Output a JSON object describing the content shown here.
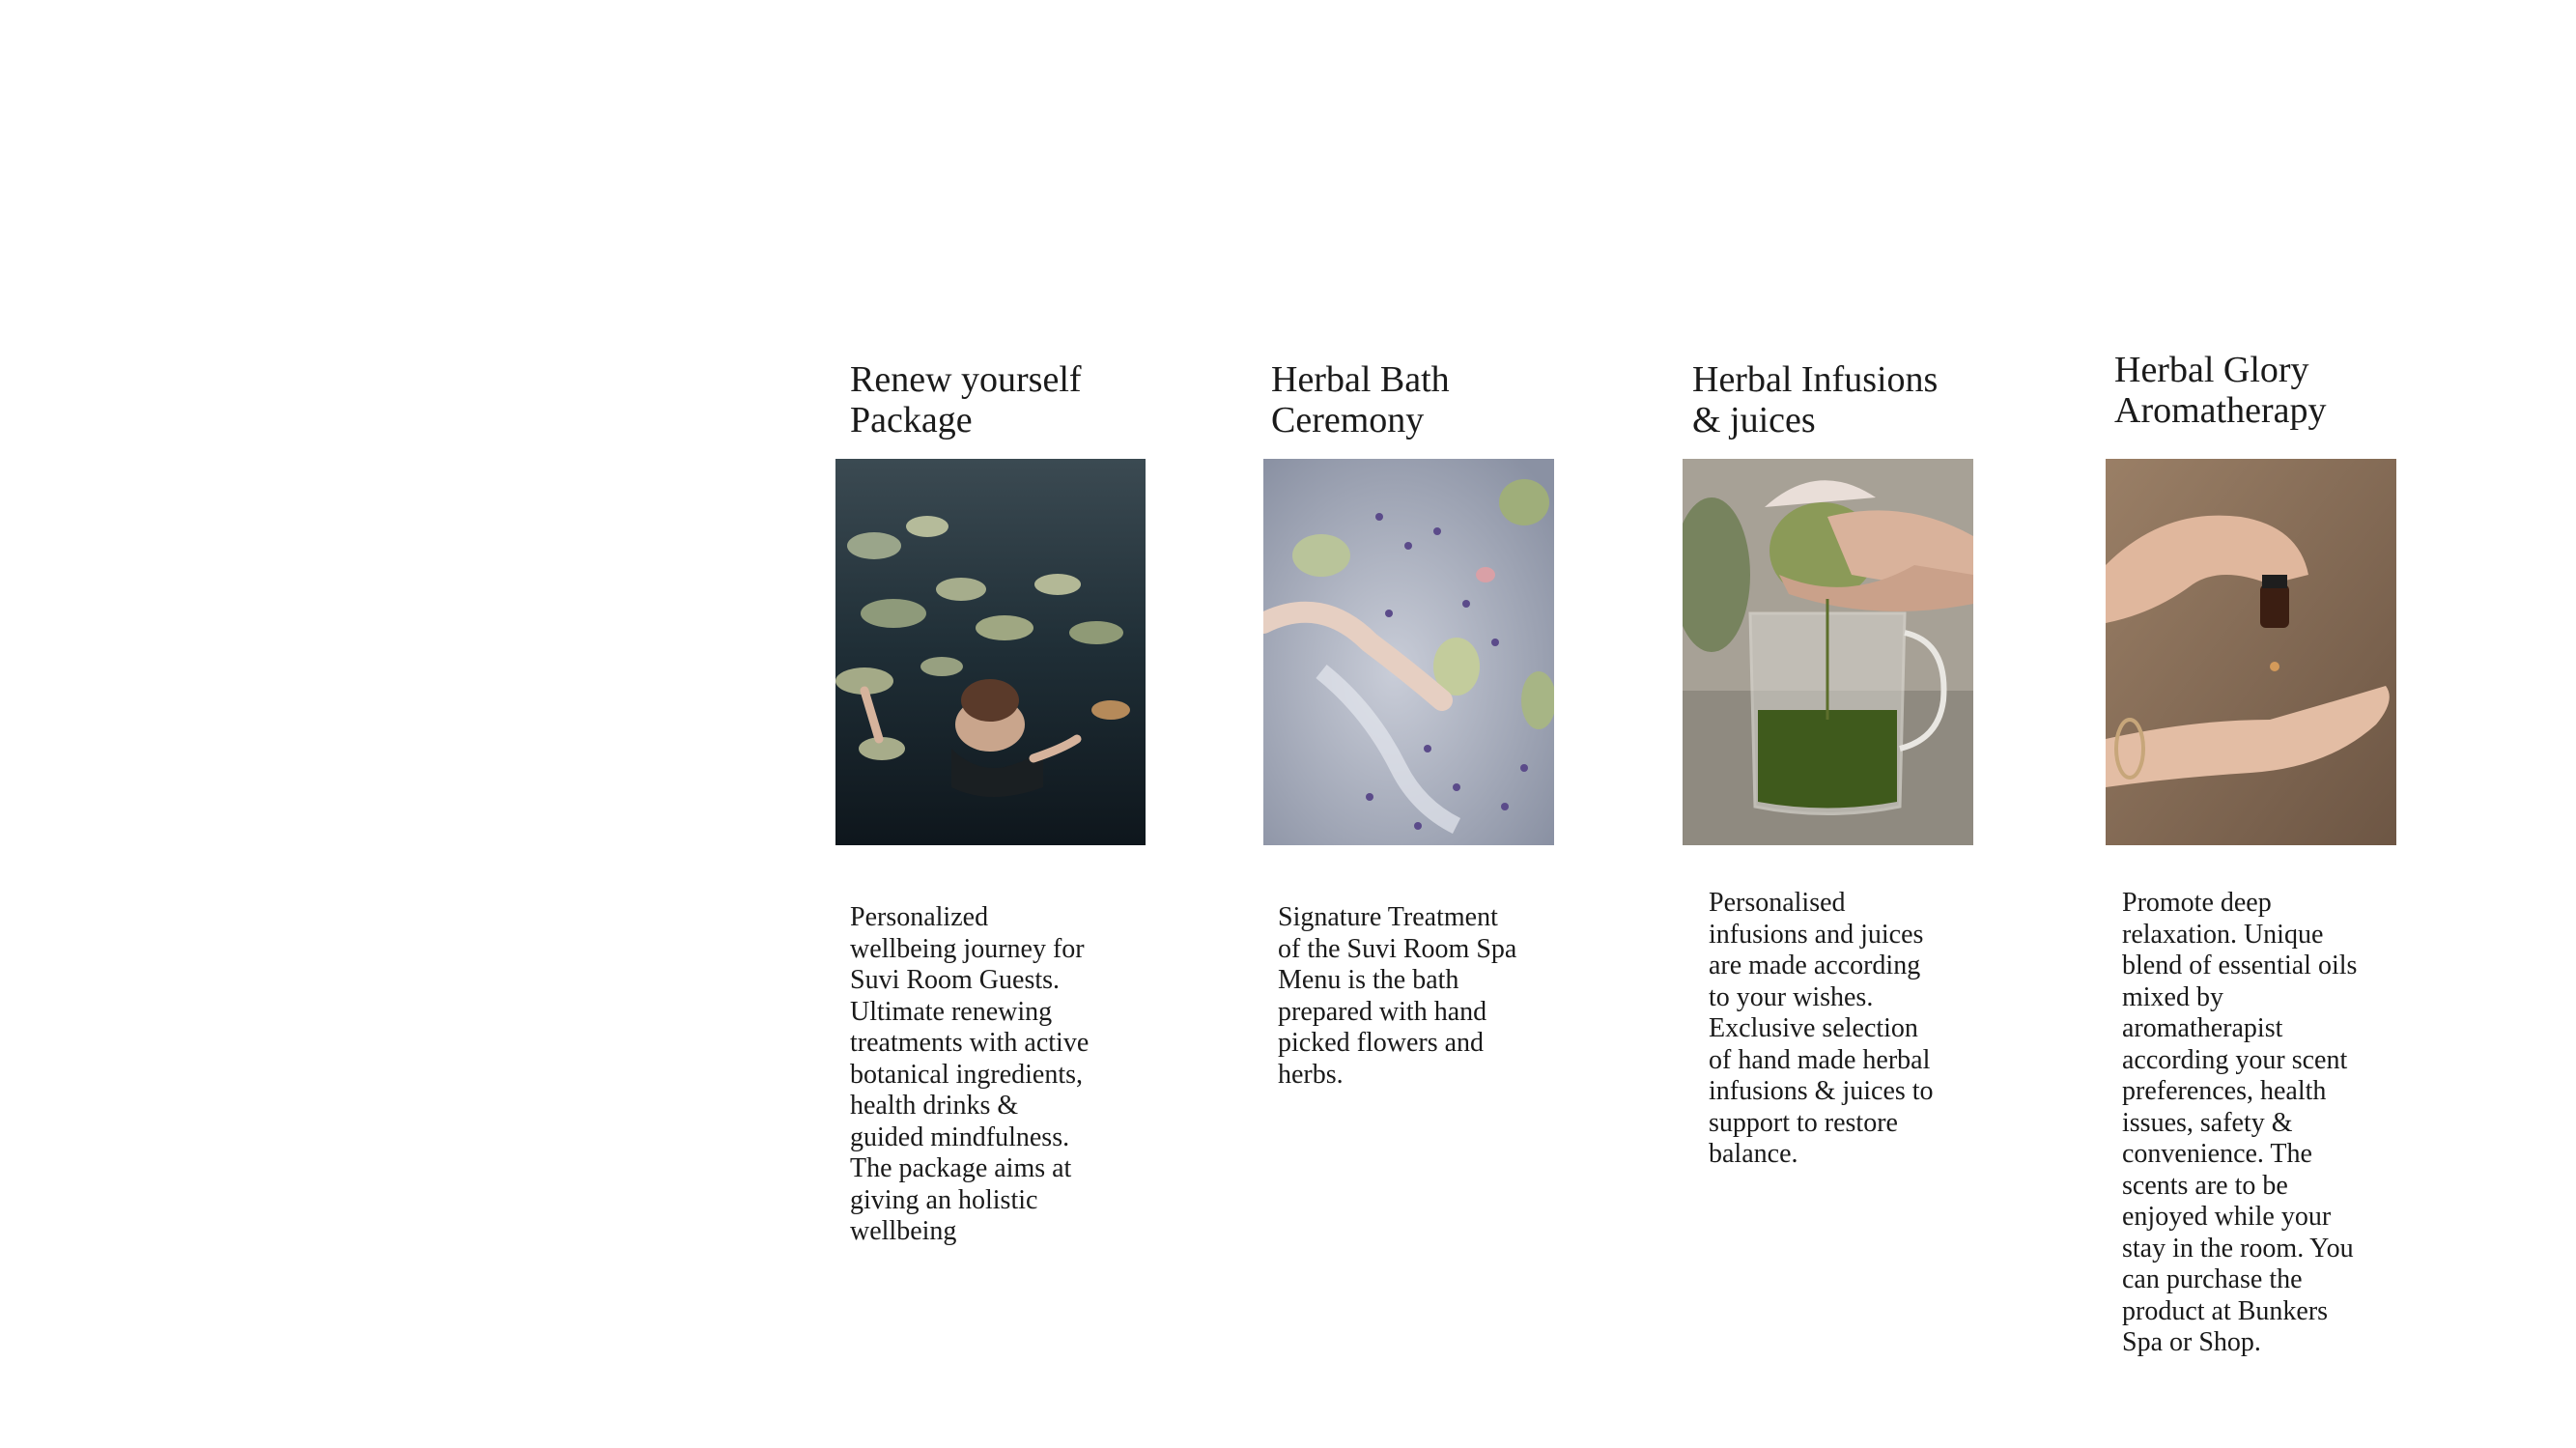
{
  "cards": [
    {
      "title": "Renew yourself\nPackage",
      "image": "woman-floating-among-water-lilies",
      "description": "Personalized\nwellbeing journey for\nSuvi Room Guests.\nUltimate renewing\ntreatments with  active\nbotanical ingredients,\nhealth drinks  &\nguided mindfulness.\nThe package aims at\ngiving an holistic\nwellbeing"
    },
    {
      "title": "Herbal Bath\nCeremony",
      "image": "hand-in-herbal-bath-with-lavender",
      "description": "Signature Treatment\nof the  Suvi Room Spa\nMenu is the bath\nprepared with hand\npicked flowers and\nherbs."
    },
    {
      "title": "Herbal Infusions\n& juices",
      "image": "hands-squeezing-herbal-juice-into-jug",
      "description": "Personalised\ninfusions and juices\nare made according\nto your wishes.\nExclusive selection\nof hand made herbal\ninfusions & juices to\nsupport to restore\nbalance."
    },
    {
      "title": "Herbal Glory\nAromatherapy",
      "image": "essential-oil-drop-onto-hand",
      "description": "Promote deep\nrelaxation. Unique\nblend of essential oils\nmixed by\naromatherapist\naccording your scent\npreferences,  health\nissues,  safety &\nconvenience. The\nscents are to be\nenjoyed while your\nstay in the room. You\ncan purchase the\nproduct at Bunkers\nSpa or Shop."
    }
  ]
}
